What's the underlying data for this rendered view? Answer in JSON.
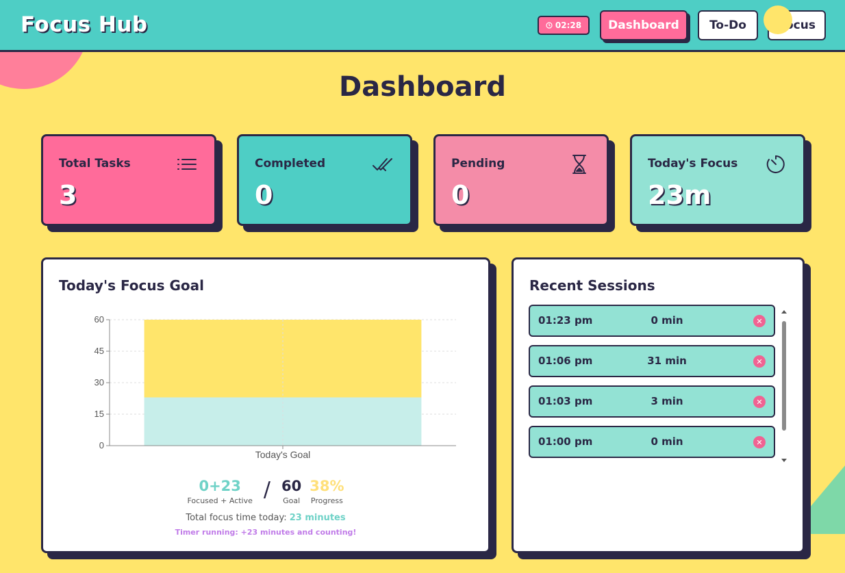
{
  "header": {
    "app_title": "Focus Hub",
    "timer": "02:28",
    "nav": [
      {
        "label": "Dashboard",
        "active": true
      },
      {
        "label": "To-Do",
        "active": false
      },
      {
        "label": "Focus",
        "active": false
      }
    ]
  },
  "page_title": "Dashboard",
  "stats": [
    {
      "label": "Total Tasks",
      "value": "3",
      "icon": "list-icon",
      "color": "#FF6B9A"
    },
    {
      "label": "Completed",
      "value": "0",
      "icon": "double-check-icon",
      "color": "#4ECEC5"
    },
    {
      "label": "Pending",
      "value": "0",
      "icon": "hourglass-icon",
      "color": "#F48CA8"
    },
    {
      "label": "Today's Focus",
      "value": "23m",
      "icon": "timer-icon",
      "color": "#93E2D4"
    }
  ],
  "focus_goal": {
    "title": "Today's Focus Goal",
    "focused_active": "0+23",
    "focused_active_label": "Focused + Active",
    "separator": "/",
    "goal": "60",
    "goal_label": "Goal",
    "progress": "38%",
    "progress_label": "Progress",
    "total_prefix": "Total focus time today:",
    "total_value": "23 minutes",
    "running_text": "Timer running: +23 minutes and counting!"
  },
  "chart_data": {
    "type": "bar",
    "stacked": true,
    "categories": [
      "Today's Goal"
    ],
    "series": [
      {
        "values": [
          23
        ],
        "color": "#C7EEEA"
      },
      {
        "values": [
          37
        ],
        "color": "#FFE56B"
      }
    ],
    "ylim": [
      0,
      60
    ],
    "yticks": [
      0,
      15,
      30,
      45,
      60
    ],
    "grid": true
  },
  "sessions": {
    "title": "Recent Sessions",
    "items": [
      {
        "time": "01:23 pm",
        "duration": "0 min"
      },
      {
        "time": "01:06 pm",
        "duration": "31 min"
      },
      {
        "time": "01:03 pm",
        "duration": "3 min"
      },
      {
        "time": "01:00 pm",
        "duration": "0 min"
      }
    ],
    "delete_glyph": "✕"
  }
}
